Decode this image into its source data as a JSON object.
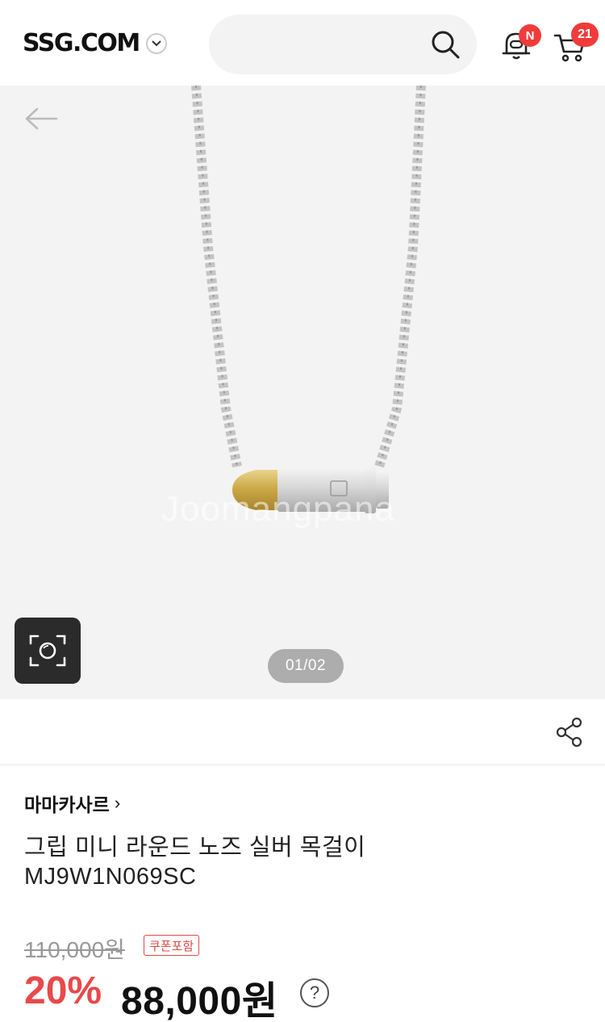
{
  "header": {
    "logo": "SSG.COM",
    "search": {
      "placeholder": ""
    },
    "notifications": {
      "badge": "N"
    },
    "cart": {
      "count": "21"
    }
  },
  "gallery": {
    "watermark": "Joomangpana",
    "page_indicator": "01/02"
  },
  "product": {
    "brand": "마마카사르",
    "brand_chevron": "›",
    "title_line1": "그립 미니 라운드 노즈 실버 목걸이",
    "title_line2": "MJ9W1N069SC",
    "original_price": "110,000원",
    "coupon_tag": "쿠폰포함",
    "discount": "20%",
    "sale_price": "88,000원",
    "help": "?"
  },
  "colors": {
    "accent_red": "#e8494b",
    "badge_red": "#f03b3b",
    "image_bg": "#f3f3f3"
  }
}
